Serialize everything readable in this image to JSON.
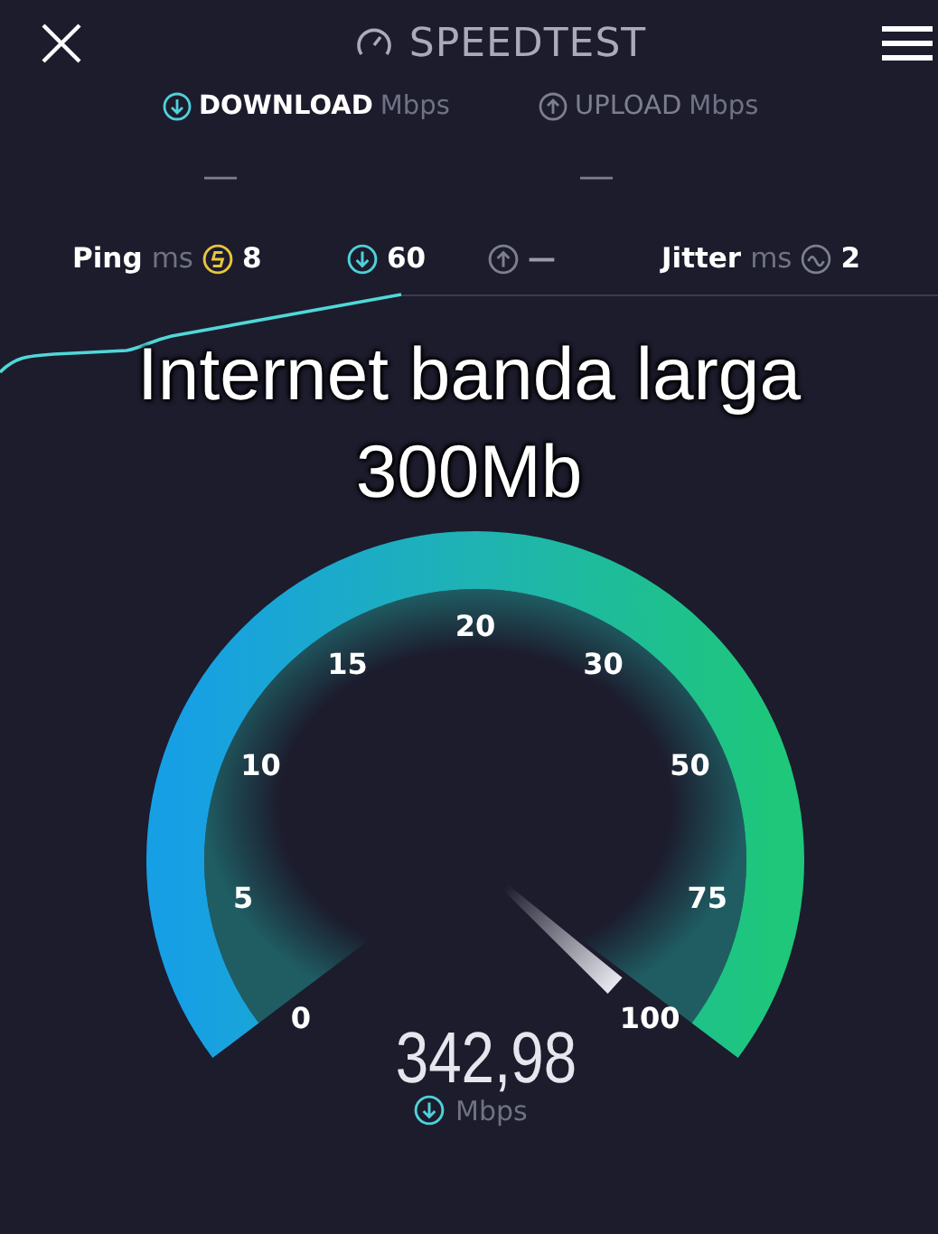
{
  "header": {
    "title": "SPEEDTEST"
  },
  "tabs": [
    {
      "kind": "download",
      "label": "DOWNLOAD",
      "unit": "Mbps",
      "value": "—",
      "selected": true
    },
    {
      "kind": "upload",
      "label": "UPLOAD",
      "unit": "Mbps",
      "value": "—",
      "selected": false
    }
  ],
  "stats": [
    {
      "kind": "ping",
      "label": "Ping",
      "unit": "ms",
      "value": "8"
    },
    {
      "kind": "download",
      "value": "60"
    },
    {
      "kind": "upload",
      "value": "—"
    },
    {
      "kind": "jitter",
      "label": "Jitter",
      "unit": "ms",
      "value": "2"
    }
  ],
  "caption": [
    "Internet banda larga",
    "300Mb"
  ],
  "gauge": {
    "ticks": [
      "0",
      "5",
      "10",
      "15",
      "20",
      "30",
      "50",
      "75",
      "100"
    ],
    "reading": "342,98",
    "unit": "Mbps"
  }
}
